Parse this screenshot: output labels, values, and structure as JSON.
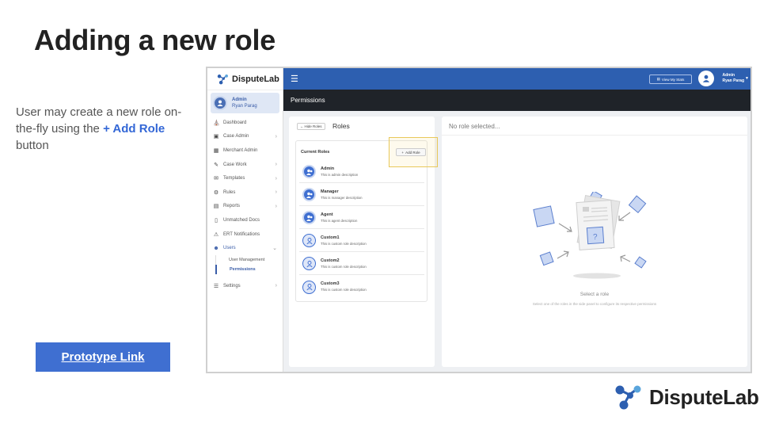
{
  "slide": {
    "title": "Adding a new role",
    "description_pre": "User may create a new role on-the-fly using the ",
    "description_highlight": "+ Add Role",
    "description_post": " button",
    "prototype_link": "Prototype Link",
    "brand_name": "DisputeLab"
  },
  "app": {
    "logo_text": "DisputeLab",
    "user": {
      "role": "Admin",
      "name": "Ryan Parag"
    },
    "nav": [
      {
        "label": "Dashboard",
        "icon": "home-icon",
        "has_children": false
      },
      {
        "label": "Case Admin",
        "icon": "briefcase-icon",
        "has_children": true
      },
      {
        "label": "Merchant Admin",
        "icon": "building-icon",
        "has_children": false
      },
      {
        "label": "Case Work",
        "icon": "edit-icon",
        "has_children": true
      },
      {
        "label": "Templates",
        "icon": "envelope-icon",
        "has_children": true
      },
      {
        "label": "Rules",
        "icon": "gear-icon",
        "has_children": true
      },
      {
        "label": "Reports",
        "icon": "file-icon",
        "has_children": true
      },
      {
        "label": "Unmatched Docs",
        "icon": "document-icon",
        "has_children": false
      },
      {
        "label": "ERT Notifications",
        "icon": "warning-icon",
        "has_children": false
      },
      {
        "label": "Users",
        "icon": "users-icon",
        "has_children": true,
        "expanded": true
      }
    ],
    "users_sub": [
      "User Management",
      "Permissions"
    ],
    "settings_label": "Settings",
    "topbar": {
      "stats_button": "View My Stats",
      "user_role": "Admin",
      "user_name": "Ryan Parag"
    },
    "page_title": "Permissions",
    "roles_panel": {
      "hide_button": "Hide Roles",
      "title": "Roles",
      "current_label": "Current Roles",
      "add_button": "Add Role",
      "roles": [
        {
          "name": "Admin",
          "description": "This is admin description",
          "type": "system"
        },
        {
          "name": "Manager",
          "description": "This is manager description",
          "type": "system"
        },
        {
          "name": "Agent",
          "description": "This is agent description",
          "type": "system"
        },
        {
          "name": "Custom1",
          "description": "This is custom role description",
          "type": "custom"
        },
        {
          "name": "Custom2",
          "description": "This is custom role description",
          "type": "custom"
        },
        {
          "name": "Custom3",
          "description": "This is custom role description",
          "type": "custom"
        }
      ]
    },
    "detail_panel": {
      "header": "No role selected...",
      "empty_title": "Select a role",
      "empty_subtitle": "Select one of the roles in the side panel to configure its respective permissions"
    }
  },
  "colors": {
    "primary": "#2d5fb0",
    "button": "#3f6fd1",
    "dark_header": "#1f2329",
    "highlight": "#e8c85a"
  }
}
